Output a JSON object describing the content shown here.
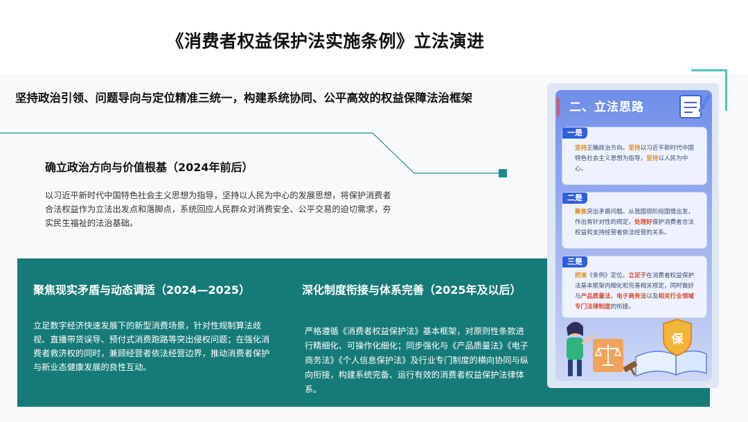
{
  "header": {
    "title": "《消费者权益保护法实施条例》立法演进",
    "subtitle": "坚持政治引领、问题导向与定位精准三统一，构建系统协同、公平高效的权益保障法治框架"
  },
  "section1": {
    "title": "确立政治方向与价值根基（2024年前后）",
    "body": "以习近平新时代中国特色社会主义思想为指导，坚持以人民为中心的发展思想，将保护消费者合法权益作为立法出发点和落脚点，系统回应人民群众对消费安全、公平交易的迫切需求，夯实民生福祉的法治基础。"
  },
  "section2": {
    "title": "聚焦现实矛盾与动态调适（2024—2025）",
    "body": "立足数字经济快速发展下的新型消费场景，针对性规制算法歧视、直播带货误导、预付式消费跑路等突出侵权问题；在强化消费者救济权的同时，兼顾经营者依法经营边界，推动消费者保护与新业态健康发展的良性互动。"
  },
  "section3": {
    "title": "深化制度衔接与体系完善（2025年及以后）",
    "body": "严格遵循《消费者权益保护法》基本框架，对原则性条款进行精细化、可操作化细化；同步强化与《产品质量法》《电子商务法》《个人信息保护法》及行业专门制度的横向协同与纵向衔接，构建系统完备、运行有效的消费者权益保护法律体系。"
  },
  "card": {
    "title": "二、立法思路",
    "points": [
      {
        "tag": "一是",
        "parts": [
          {
            "t": "坚持",
            "c": "hl-o"
          },
          {
            "t": "正确政治方向。",
            "c": ""
          },
          {
            "t": "坚持",
            "c": "hl-o"
          },
          {
            "t": "以习近平新时代中国特色社会主义思想为指导，",
            "c": ""
          },
          {
            "t": "坚持",
            "c": "hl-o"
          },
          {
            "t": "以人民为中心。",
            "c": ""
          }
        ]
      },
      {
        "tag": "二是",
        "parts": [
          {
            "t": "聚焦",
            "c": "hl-o"
          },
          {
            "t": "突出矛盾问题。从我国现阶段国情出发，作出有针对性的规定，",
            "c": ""
          },
          {
            "t": "处理好",
            "c": "hl"
          },
          {
            "t": "保护消费者合法权益和支持经营者依法经营的关系。",
            "c": ""
          }
        ]
      },
      {
        "tag": "三是",
        "parts": [
          {
            "t": "把准",
            "c": "hl-o"
          },
          {
            "t": "《条例》定位。",
            "c": ""
          },
          {
            "t": "立足于",
            "c": "hl"
          },
          {
            "t": "在消费者权益保护法基本框架内细化和完善相关规定，同时做好与",
            "c": ""
          },
          {
            "t": "产品质量法、电子商务法",
            "c": "hl"
          },
          {
            "t": "以及",
            "c": ""
          },
          {
            "t": "相关行业领域专门法律制度",
            "c": "hl"
          },
          {
            "t": "的衔接。",
            "c": ""
          }
        ]
      }
    ],
    "badge": "保"
  },
  "colors": {
    "teal_panel": "#167a78",
    "accent_blue": "#2f5fe0",
    "highlight_red": "#d9482b",
    "highlight_orange": "#e08a1c"
  },
  "icons": [
    "notebook-pen-icon",
    "scales-of-justice-icon",
    "law-book-icon",
    "gavel-icon"
  ]
}
